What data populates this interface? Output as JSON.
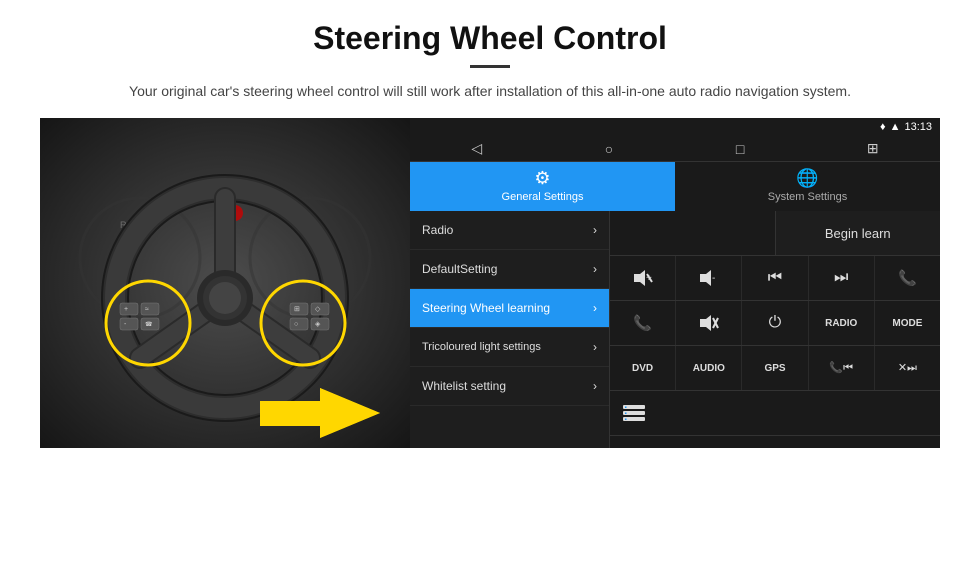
{
  "title": "Steering Wheel Control",
  "divider": "",
  "subtitle": "Your original car's steering wheel control will still work after installation of this all-in-one auto radio navigation system.",
  "tabs": [
    {
      "label": "General Settings",
      "active": true,
      "icon": "⚙"
    },
    {
      "label": "System Settings",
      "active": false,
      "icon": "🔧"
    }
  ],
  "statusBar": {
    "location": "♦",
    "signal": "▲",
    "time": "13:13"
  },
  "navBar": {
    "back": "◁",
    "home": "○",
    "recents": "□",
    "menu": "⊞"
  },
  "menuItems": [
    {
      "label": "Radio",
      "active": false
    },
    {
      "label": "DefaultSetting",
      "active": false
    },
    {
      "label": "Steering Wheel learning",
      "active": true
    },
    {
      "label": "Tricoloured light settings",
      "active": false
    },
    {
      "label": "Whitelist setting",
      "active": false
    }
  ],
  "controlGrid": {
    "beginLearnLabel": "Begin learn",
    "row1": [
      {
        "icon": "🔊+",
        "label": "vol up"
      },
      {
        "icon": "🔊-",
        "label": "vol down"
      },
      {
        "icon": "⏮",
        "label": "prev"
      },
      {
        "icon": "⏭",
        "label": "next"
      },
      {
        "icon": "📞",
        "label": "call"
      }
    ],
    "row2": [
      {
        "icon": "📞",
        "label": "answer"
      },
      {
        "icon": "🔊✕",
        "label": "mute"
      },
      {
        "icon": "⏻",
        "label": "power"
      },
      {
        "label": "RADIO"
      },
      {
        "label": "MODE"
      }
    ],
    "row3": [
      {
        "label": "DVD"
      },
      {
        "label": "AUDIO"
      },
      {
        "label": "GPS"
      },
      {
        "icon": "📞⏮",
        "label": ""
      },
      {
        "icon": "✕⏭",
        "label": ""
      }
    ],
    "row4": [
      {
        "icon": "≡",
        "label": ""
      }
    ]
  }
}
